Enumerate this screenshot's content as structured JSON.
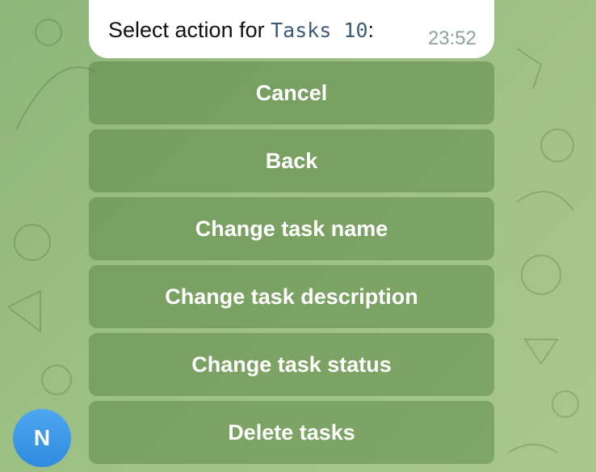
{
  "message": {
    "text_prefix": "Select action for ",
    "code_text": "Tasks 10",
    "text_suffix": ":",
    "time": "23:52"
  },
  "keyboard": {
    "buttons": [
      {
        "label": "Cancel"
      },
      {
        "label": "Back"
      },
      {
        "label": "Change task name"
      },
      {
        "label": "Change task description"
      },
      {
        "label": "Change task status"
      },
      {
        "label": "Delete tasks"
      }
    ]
  },
  "avatar": {
    "initial": "N",
    "color": "#3d99ea"
  },
  "colors": {
    "background": "#9dc083",
    "button_bg": "#6f9a57",
    "bubble_bg": "#ffffff",
    "code_text": "#3a5a7a",
    "time_text": "#8ea39a"
  }
}
